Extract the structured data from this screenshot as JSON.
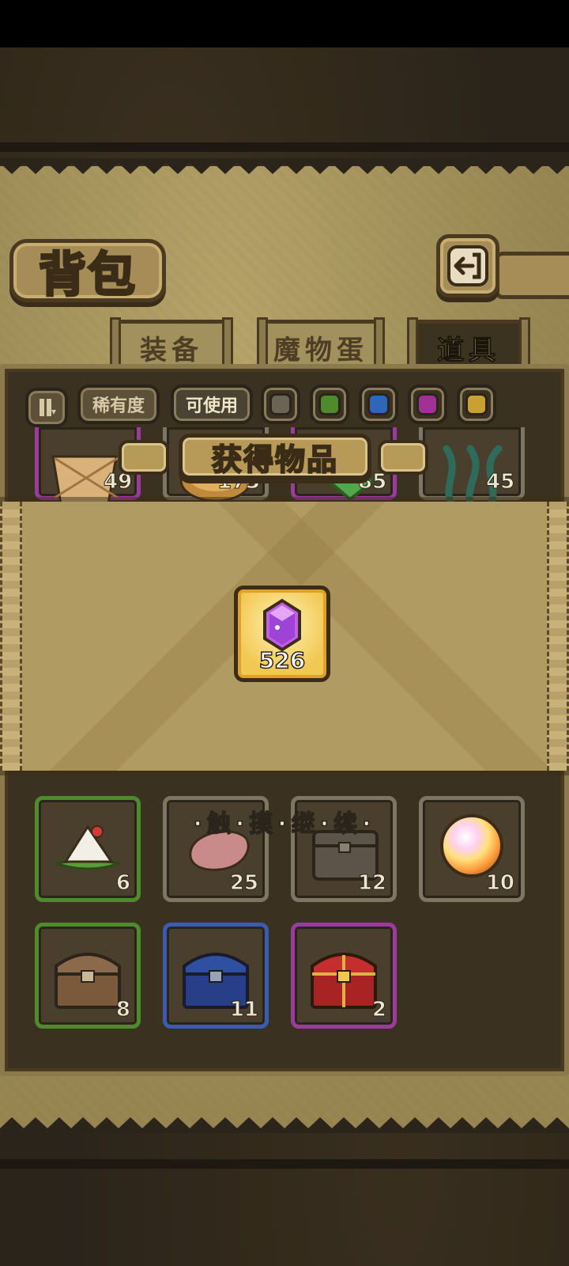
{
  "screen": {
    "title": "背包",
    "back_icon": "back-arrow-icon"
  },
  "tabs": [
    {
      "label": "装备",
      "active": false
    },
    {
      "label": "魔物蛋",
      "active": false
    },
    {
      "label": "道具",
      "active": true
    }
  ],
  "filters": {
    "toggle_icon": "pause-sort-icon",
    "rarity_label": "稀有度",
    "usable_label": "可使用",
    "color_swatches": [
      "#6b6454",
      "#4f8a2c",
      "#2f66b8",
      "#a23196",
      "#c9a032"
    ]
  },
  "partial_row": {
    "counts": [
      "49",
      "173",
      "85",
      "45"
    ],
    "icons": [
      "bread-basket-icon",
      "pie-icon",
      "green-frame-icon",
      "seaweed-icon"
    ]
  },
  "popup": {
    "title": "获得物品",
    "reward": {
      "icon": "purple-gem-icon",
      "quantity": "526"
    },
    "continue_text": "·触·摸·继·续·"
  },
  "items": [
    {
      "icon": "rice-dumpling-icon",
      "count": "6",
      "rarity": "green"
    },
    {
      "icon": "raw-meat-icon",
      "count": "25",
      "rarity": "grey"
    },
    {
      "icon": "wooden-chest-icon",
      "count": "12",
      "rarity": "grey"
    },
    {
      "icon": "rainbow-orb-icon",
      "count": "10",
      "rarity": "grey"
    },
    {
      "icon": "bronze-chest-icon",
      "count": "8",
      "rarity": "green"
    },
    {
      "icon": "blue-chest-icon",
      "count": "11",
      "rarity": "blue"
    },
    {
      "icon": "red-chest-icon",
      "count": "2",
      "rarity": "purple"
    }
  ]
}
